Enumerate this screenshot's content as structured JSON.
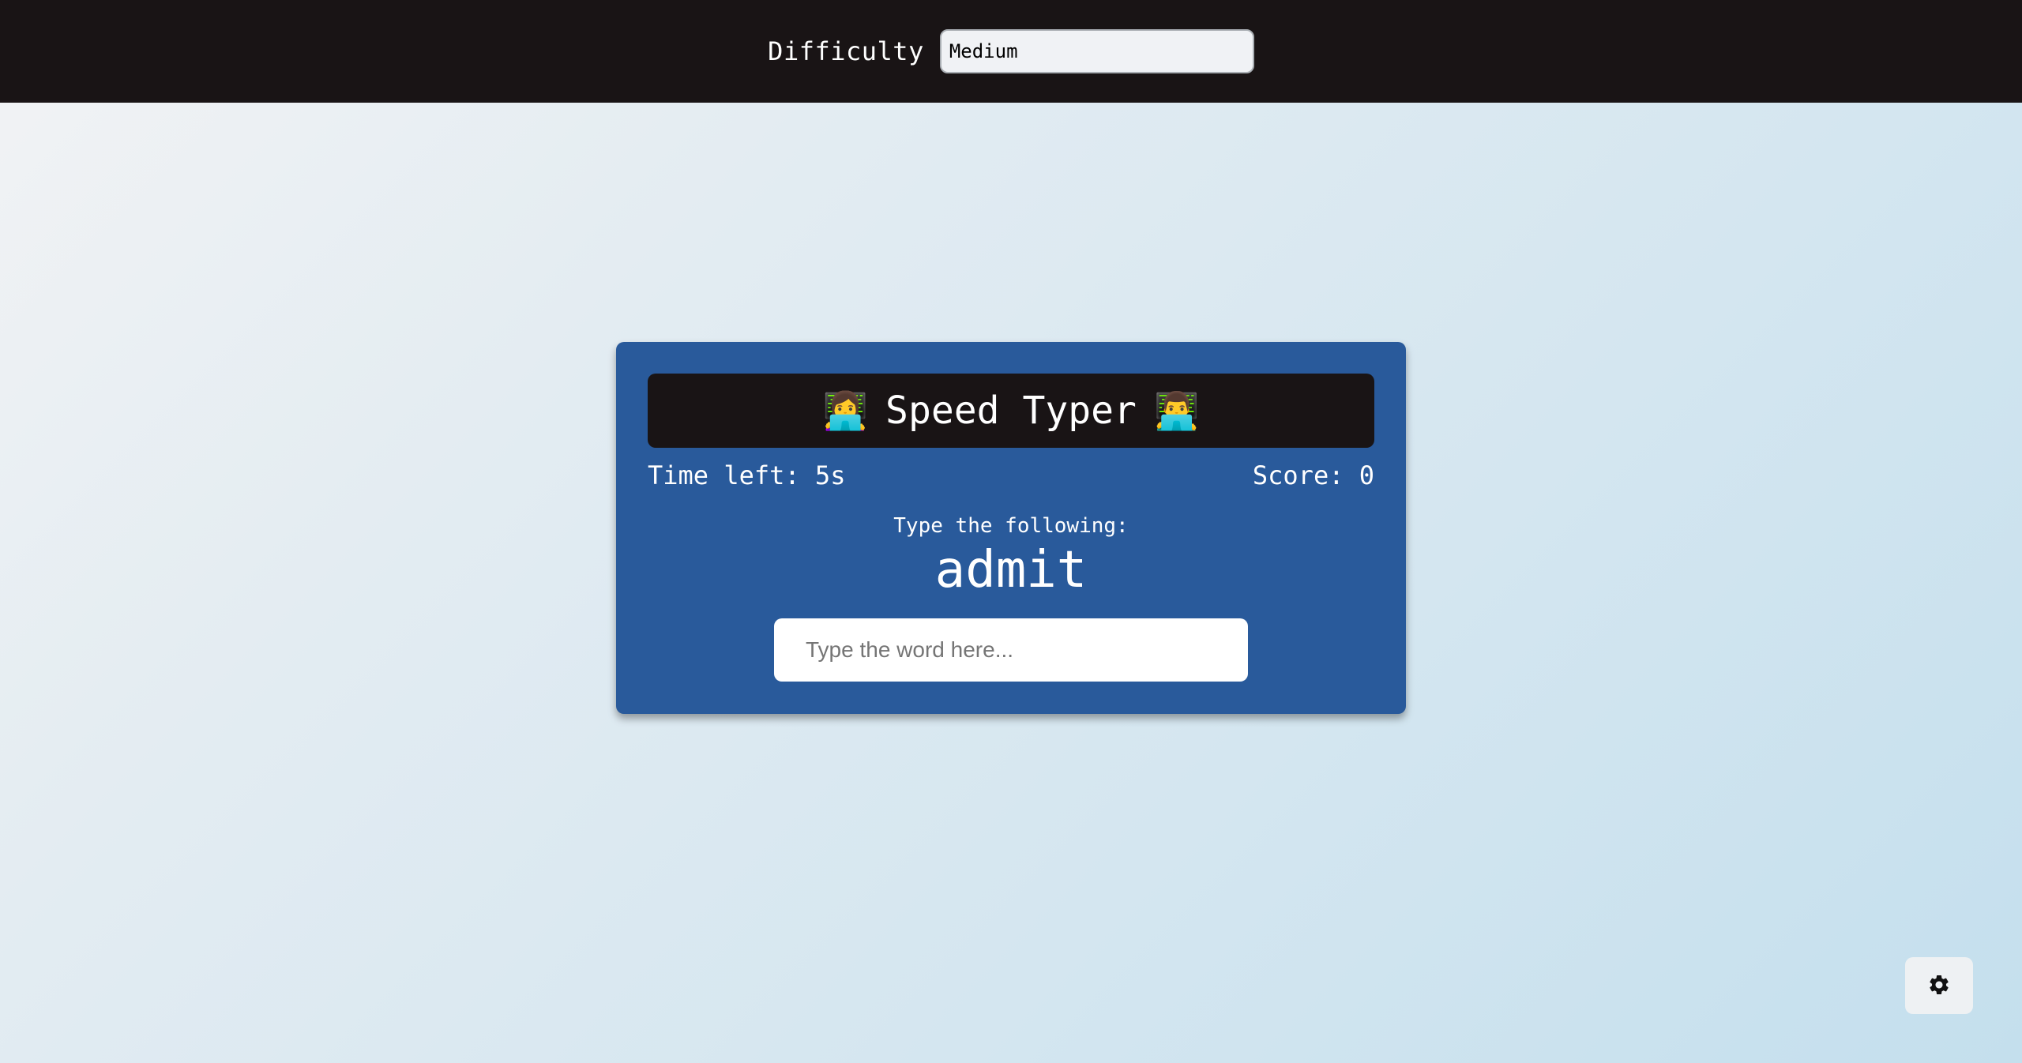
{
  "header": {
    "difficulty_label": "Difficulty",
    "difficulty_value": "Medium"
  },
  "game": {
    "title": "Speed Typer",
    "title_icon_left": "woman-technologist-emoji",
    "title_icon_right": "man-technologist-emoji",
    "time_left": "Time left: 5s",
    "score": "Score: 0",
    "prompt_label": "Type the following:",
    "target_word": "admit",
    "input_placeholder": "Type the word here...",
    "input_value": ""
  },
  "settings": {
    "icon": "gear-icon"
  },
  "colors": {
    "topbar": "#191415",
    "card": "#295a9b",
    "card_header": "#191415",
    "text": "#ffffff"
  }
}
